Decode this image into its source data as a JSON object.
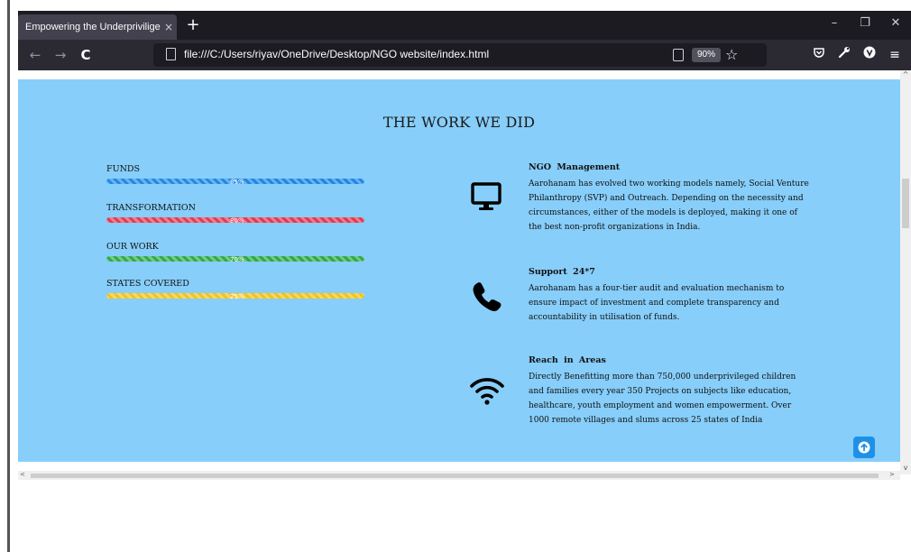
{
  "browser": {
    "tab_title": "Empowering the Underpriviliged",
    "tab_close": "×",
    "new_tab": "+",
    "url": "file:///C:/Users/riyav/OneDrive/Desktop/NGO website/index.html",
    "zoom": "90%",
    "window_controls": [
      "–",
      "❐",
      "✕"
    ],
    "nav": {
      "back": "←",
      "forward": "→",
      "reload": "C"
    }
  },
  "section": {
    "title": "THE WORK WE DID",
    "background": "#87cefa"
  },
  "skills": [
    {
      "label": "FUNDS",
      "percent": 100,
      "percent_label": "85%",
      "color": "#1e88e5"
    },
    {
      "label": "TRANSFORMATION",
      "percent": 100,
      "percent_label": "80%",
      "color": "#e53950"
    },
    {
      "label": "OUR WORK",
      "percent": 100,
      "percent_label": "70%",
      "color": "#2eaa49"
    },
    {
      "label": "STATES COVERED",
      "percent": 100,
      "percent_label": "25%",
      "color": "#f2c319"
    }
  ],
  "services": [
    {
      "icon": "desktop-icon",
      "title": "NGO Management",
      "text": "Aarohanam has evolved two working models namely, Social Venture Philanthropy (SVP) and Outreach. Depending on the necessity and circumstances, either of the models is deployed, making it one of the best non-profit organizations in India."
    },
    {
      "icon": "phone-icon",
      "title": "Support 24*7",
      "text": "Aarohanam has a four-tier audit and evaluation mechanism to ensure impact of investment and complete transparency and accountability in utilisation of funds."
    },
    {
      "icon": "wifi-icon",
      "title": "Reach in Areas",
      "text": "Directly Benefitting more than 750,000 underprivileged children and families every year 350 Projects on subjects like education, healthcare, youth employment and women empowerment. Over 1000 remote villages and slums across 25 states of India"
    }
  ]
}
